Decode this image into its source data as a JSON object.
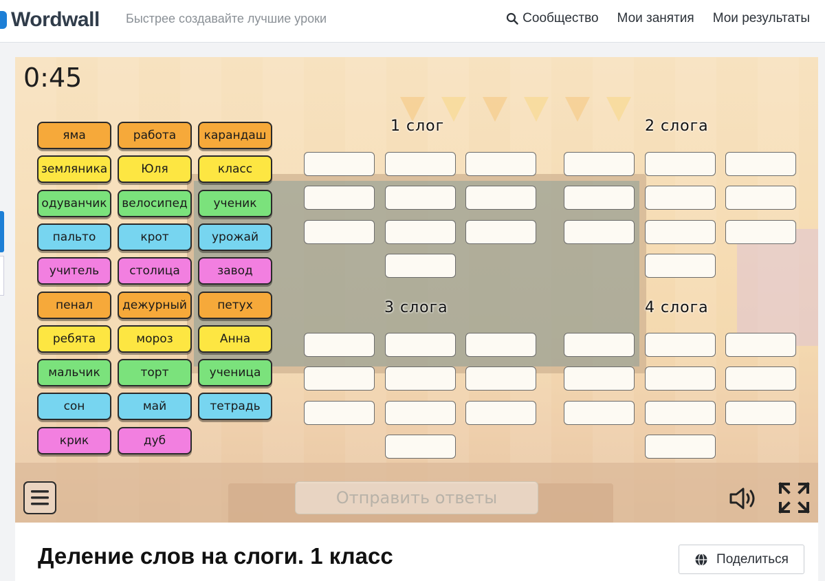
{
  "header": {
    "logo_text": "Wordwall",
    "tagline": "Быстрее создавайте лучшие уроки",
    "nav": [
      {
        "label": "Сообщество",
        "icon": "search-icon"
      },
      {
        "label": "Мои занятия"
      },
      {
        "label": "Мои результаты"
      }
    ]
  },
  "game": {
    "timer": "0:45",
    "words": [
      {
        "text": "яма",
        "color": "orange"
      },
      {
        "text": "работа",
        "color": "orange"
      },
      {
        "text": "карандаш",
        "color": "orange"
      },
      {
        "text": "земляника",
        "color": "yellow"
      },
      {
        "text": "Юля",
        "color": "yellow"
      },
      {
        "text": "класс",
        "color": "yellow"
      },
      {
        "text": "одуванчик",
        "color": "green"
      },
      {
        "text": "велосипед",
        "color": "green"
      },
      {
        "text": "ученик",
        "color": "green"
      },
      {
        "text": "пальто",
        "color": "blue"
      },
      {
        "text": "крот",
        "color": "blue"
      },
      {
        "text": "урожай",
        "color": "blue"
      },
      {
        "text": "учитель",
        "color": "pink"
      },
      {
        "text": "столица",
        "color": "pink"
      },
      {
        "text": "завод",
        "color": "pink"
      },
      {
        "text": "пенал",
        "color": "orange"
      },
      {
        "text": "дежурный",
        "color": "orange"
      },
      {
        "text": "петух",
        "color": "orange"
      },
      {
        "text": "ребята",
        "color": "yellow"
      },
      {
        "text": "мороз",
        "color": "yellow"
      },
      {
        "text": "Анна",
        "color": "yellow"
      },
      {
        "text": "мальчик",
        "color": "green"
      },
      {
        "text": "торт",
        "color": "green"
      },
      {
        "text": "ученица",
        "color": "green"
      },
      {
        "text": "сон",
        "color": "blue"
      },
      {
        "text": "май",
        "color": "blue"
      },
      {
        "text": "тетрадь",
        "color": "blue"
      },
      {
        "text": "крик",
        "color": "pink"
      },
      {
        "text": "дуб",
        "color": "pink"
      }
    ],
    "groups": [
      {
        "title": "1 слог",
        "slots": 10
      },
      {
        "title": "2 слога",
        "slots": 10
      },
      {
        "title": "3 слога",
        "slots": 10
      },
      {
        "title": "4 слога",
        "slots": 10
      }
    ],
    "submit_label": "Отправить ответы",
    "menu_icon": "hamburger-menu-icon",
    "sound_icon": "speaker-icon",
    "fullscreen_icon": "fullscreen-icon"
  },
  "activity": {
    "title": "Деление слов на слоги. 1 класс",
    "share_label": "Поделиться",
    "share_icon": "globe-icon"
  },
  "colors": {
    "orange": "#f6a93a",
    "yellow": "#fde642",
    "green": "#7be27c",
    "blue": "#77d5f0",
    "pink": "#f27fe0",
    "brand": "#1d7fd6"
  }
}
